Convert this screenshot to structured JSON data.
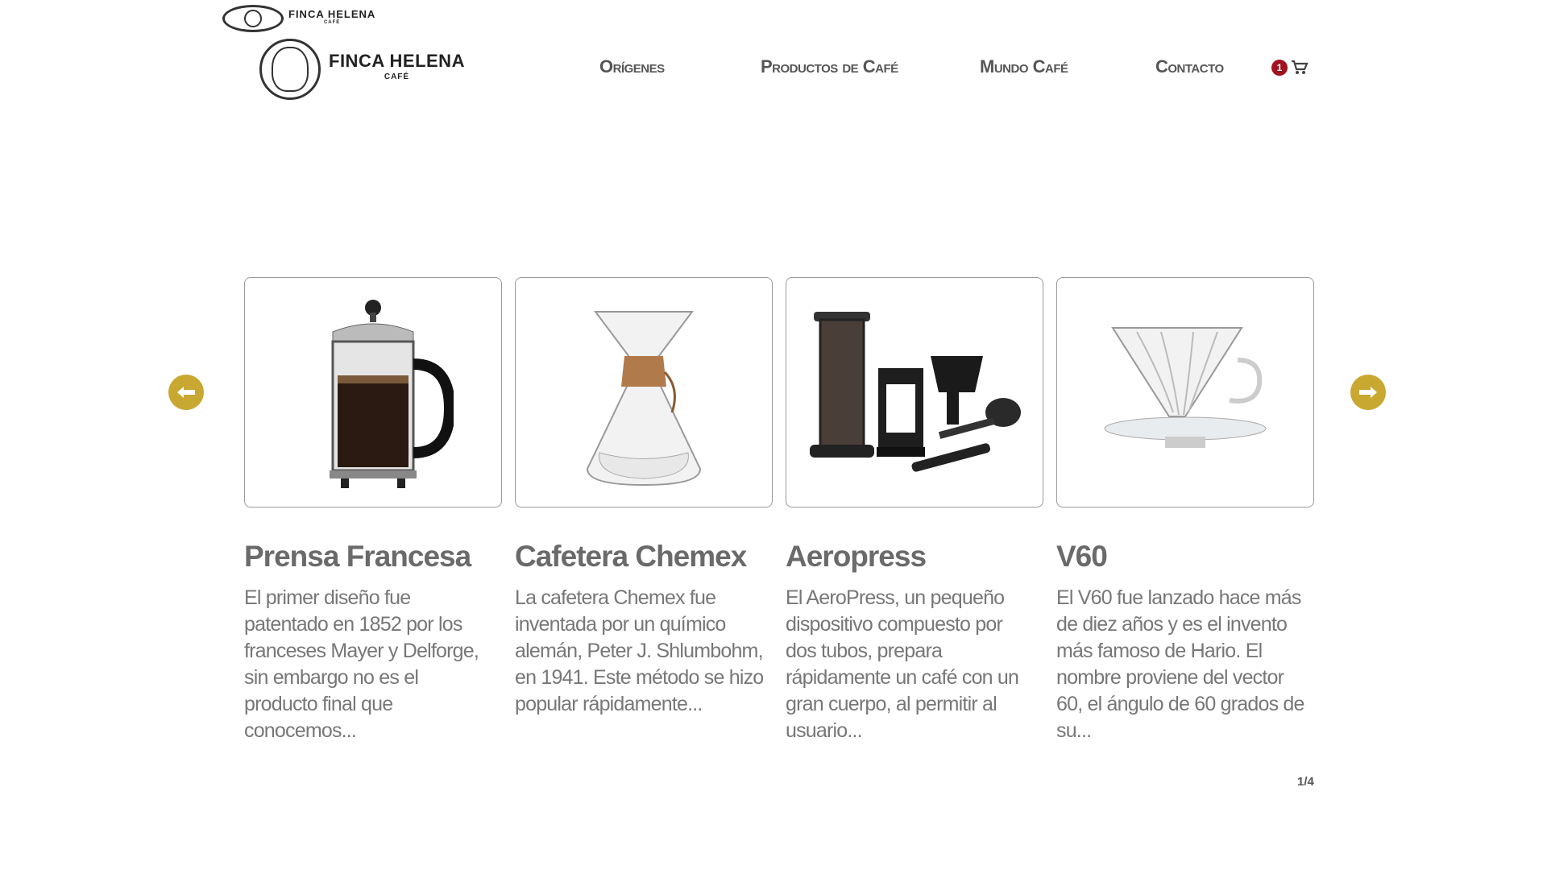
{
  "small_logo": {
    "brand": "FINCA HELENA",
    "sub": "CAFÉ"
  },
  "header": {
    "brand": "FINCA HELENA",
    "sub": "CAFÉ"
  },
  "nav": {
    "items": [
      {
        "label": "Orígenes"
      },
      {
        "label": "Productos de Café"
      },
      {
        "label": "Mundo Café"
      },
      {
        "label": "Contacto"
      }
    ],
    "cart_count": "1"
  },
  "carousel": {
    "cards": [
      {
        "title": "Prensa Francesa",
        "text": "El primer diseño fue patentado en 1852 por los franceses Mayer y Delforge, sin embargo no es el producto final que conocemos..."
      },
      {
        "title": "Cafetera Chemex",
        "text": "La cafetera Chemex fue inventada por un químico alemán, Peter J. Shlumbohm, en 1941. Este método se hizo popular rápidamente..."
      },
      {
        "title": "Aeropress",
        "text": "El AeroPress, un pequeño dispositivo compuesto por dos tubos, prepara rápidamente un café con un gran cuerpo, al permitir al usuario..."
      },
      {
        "title": "V60",
        "text": "El V60 fue lanzado hace más de diez años y es el invento más famoso de Hario. El nombre proviene del vector 60, el ángulo de 60 grados de su..."
      }
    ],
    "pager": "1/4"
  },
  "colors": {
    "accent": "#c9a832",
    "badge": "#a0121f",
    "text": "#6a6a6a"
  },
  "icons": [
    "logo-medallion-icon",
    "cart-icon",
    "arrow-left-icon",
    "arrow-right-icon"
  ]
}
